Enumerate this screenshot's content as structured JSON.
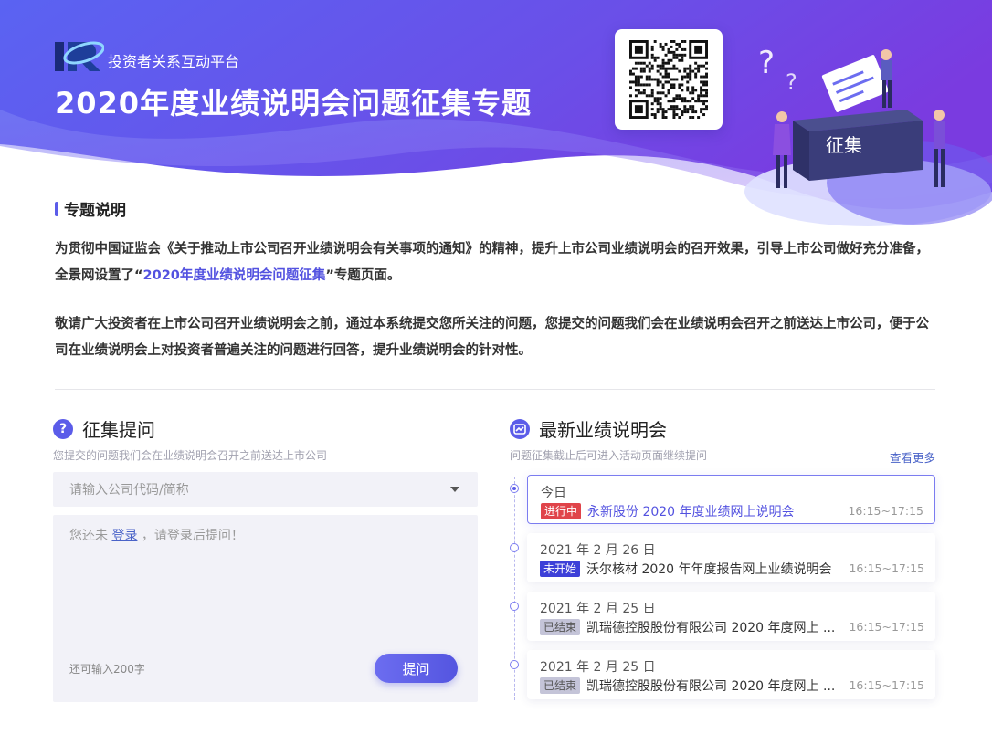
{
  "colors": {
    "accent": "#5b5ce9",
    "hero_start": "#5b61f0",
    "hero_end": "#7b3fe0",
    "link": "#4a63c8",
    "status_live": "#e0444a",
    "status_upcoming": "#3d40d8",
    "status_ended": "#c4c4d8"
  },
  "header": {
    "logo_text": "IR",
    "subtitle": "投资者关系互动平台",
    "title": "2020年度业绩说明会问题征集专题",
    "illustration_label": "征集"
  },
  "intro": {
    "section_title": "专题说明",
    "para1_before": "为贯彻中国证监会《关于推动上市公司召开业绩说明会有关事项的通知》的精神，提升上市公司业绩说明会的召开效果，引导上市公司做好充分准备，全景网设置了“",
    "para1_highlight": "2020年度业绩说明会问题征集",
    "para1_after": "”专题页面。",
    "para2": "敬请广大投资者在上市公司召开业绩说明会之前，通过本系统提交您所关注的问题，您提交的问题我们会在业绩说明会召开之前送达上市公司，便于公司在业绩说明会上对投资者普遍关注的问题进行回答，提升业绩说明会的针对性。"
  },
  "ask": {
    "title": "征集提问",
    "subtitle": "您提交的问题我们会在业绩说明会召开之前送达上市公司",
    "company_placeholder": "请输入公司代码/简称",
    "hint_before": "您还未",
    "login_label": "登录",
    "hint_after": "，请登录后提问！",
    "char_count": "还可输入200字",
    "submit_label": "提问"
  },
  "latest": {
    "title": "最新业绩说明会",
    "subtitle": "问题征集截止后可进入活动页面继续提问",
    "more_label": "查看更多",
    "items": [
      {
        "date": "今日",
        "status": "进行中",
        "title": "永新股份 2020 年度业绩网上说明会",
        "time": "16:15~17:15"
      },
      {
        "date": "2021 年 2 月 26 日",
        "status": "未开始",
        "title": "沃尔核材 2020 年年度报告网上业绩说明会",
        "time": "16:15~17:15"
      },
      {
        "date": "2021 年 2 月 25 日",
        "status": "已结束",
        "title": "凯瑞德控股股份有限公司 2020 年度网上 ...",
        "time": "16:15~17:15"
      },
      {
        "date": "2021 年 2 月 25 日",
        "status": "已结束",
        "title": "凯瑞德控股股份有限公司 2020 年度网上 ...",
        "time": "16:15~17:15"
      }
    ]
  }
}
